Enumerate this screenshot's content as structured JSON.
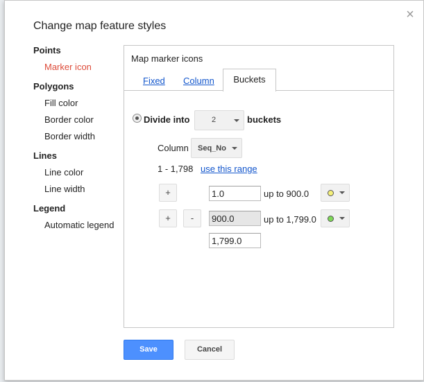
{
  "dialog": {
    "title": "Change map feature styles",
    "close_label": "×"
  },
  "sidebar": {
    "groups": [
      {
        "label": "Points",
        "items": [
          "Marker icon"
        ]
      },
      {
        "label": "Polygons",
        "items": [
          "Fill color",
          "Border color",
          "Border width"
        ]
      },
      {
        "label": "Lines",
        "items": [
          "Line color",
          "Line width"
        ]
      },
      {
        "label": "Legend",
        "items": [
          "Automatic legend"
        ]
      }
    ],
    "active_item": "Marker icon"
  },
  "panel": {
    "title": "Map marker icons",
    "tabs": [
      "Fixed",
      "Column",
      "Buckets"
    ],
    "active_tab": "Buckets"
  },
  "buckets": {
    "divide_label": "Divide into",
    "count": "2",
    "buckets_label": "buckets",
    "column_label": "Column",
    "column_value": "Seq_No",
    "range_text": "1 - 1,798",
    "use_range_link": "use this range",
    "plus_label": "+",
    "minus_label": "-",
    "rows": [
      {
        "from": "1.0",
        "upto_label": "up to 900.0",
        "marker_color": "#f5f07a"
      },
      {
        "from": "900.0",
        "upto_label": "up to 1,799.0",
        "marker_color": "#7ed957"
      }
    ],
    "last_value": "1,799.0"
  },
  "footer": {
    "save_label": "Save",
    "cancel_label": "Cancel"
  },
  "colors": {
    "accent_blue": "#4d90fe",
    "link_blue": "#1155cc",
    "active_red": "#dd4b39"
  }
}
